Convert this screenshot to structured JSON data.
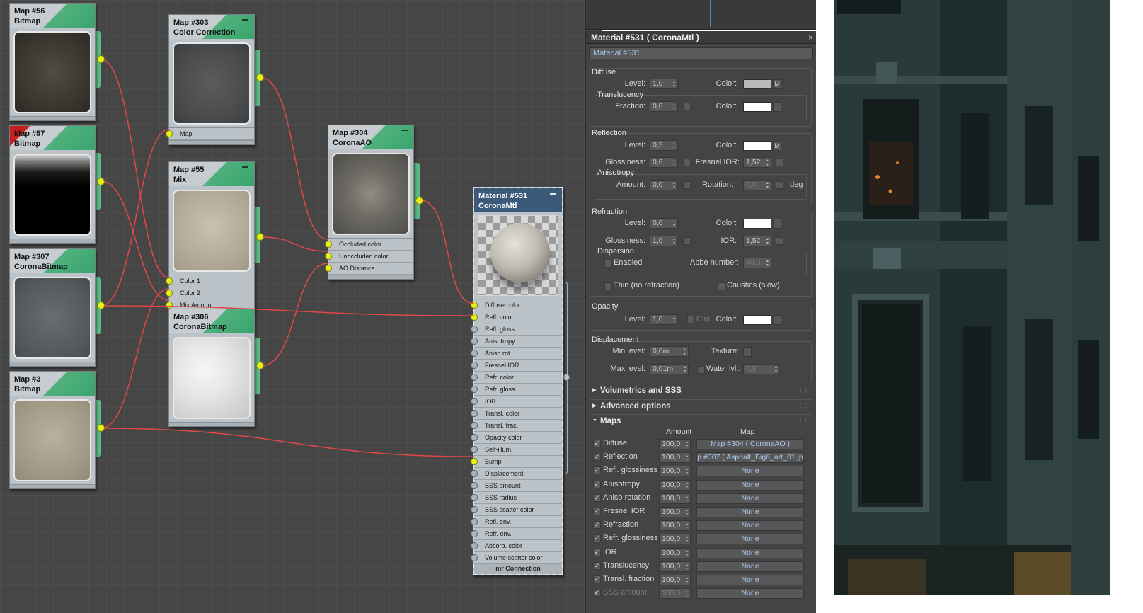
{
  "nodes": {
    "map56": {
      "title": "Map #56",
      "type": "Bitmap"
    },
    "map57": {
      "title": "Map #57",
      "type": "Bitmap"
    },
    "map307": {
      "title": "Map #307",
      "type": "CoronaBitmap"
    },
    "map3": {
      "title": "Map #3",
      "type": "Bitmap"
    },
    "map303": {
      "title": "Map #303",
      "type": "Color Correction",
      "inputs": [
        "Map"
      ]
    },
    "map55": {
      "title": "Map #55",
      "type": "Mix",
      "inputs": [
        "Color 1",
        "Color 2",
        "Mix Amount"
      ]
    },
    "map306": {
      "title": "Map #306",
      "type": "CoronaBitmap"
    },
    "map304": {
      "title": "Map #304",
      "type": "CoronaAO",
      "inputs": [
        "Occluded color",
        "Unoccluded color",
        "AO Distance"
      ]
    },
    "material": {
      "title": "Material #531",
      "type": "CoronaMtl",
      "inputs": [
        "Diffuse color",
        "Refl. color",
        "Refl. gloss.",
        "Anisotropy",
        "Aniso rot.",
        "Fresnel IOR",
        "Refr. color",
        "Refr. gloss.",
        "IOR",
        "Transl. color",
        "Transl. frac.",
        "Opacity color",
        "Self-illum.",
        "Bump",
        "Displacement",
        "SSS amount",
        "SSS radius",
        "SSS scatter color",
        "Refl. env.",
        "Refr. env.",
        "Absorb. color",
        "Volume scatter color"
      ],
      "connected": [
        0,
        1,
        13
      ],
      "footer": "mr Connection"
    }
  },
  "panel": {
    "title": "Material #531  ( CoronaMtl )",
    "close": "×",
    "name": "Material #531",
    "diffuse": {
      "header": "Diffuse",
      "level_label": "Level:",
      "level": "1,0",
      "color_label": "Color:",
      "color": "#b9b9b9",
      "m": "M",
      "translucency": {
        "header": "Translucency",
        "fraction_label": "Fraction:",
        "fraction": "0,0",
        "color_label": "Color:",
        "color": "#ffffff"
      }
    },
    "reflection": {
      "header": "Reflection",
      "level_label": "Level:",
      "level": "0,5",
      "color_label": "Color:",
      "color": "#ffffff",
      "m": "M",
      "gloss_label": "Glossiness:",
      "gloss": "0,6",
      "fresnel_label": "Fresnel IOR:",
      "fresnel": "1,52",
      "anisotropy": {
        "header": "Anisotropy",
        "amount_label": "Amount:",
        "amount": "0,0",
        "rotation_label": "Rotation:",
        "rotation": "0,0",
        "unit": "deg"
      }
    },
    "refraction": {
      "header": "Refraction",
      "level_label": "Level:",
      "level": "0,0",
      "color_label": "Color:",
      "color": "#ffffff",
      "gloss_label": "Glossiness:",
      "gloss": "1,0",
      "ior_label": "IOR:",
      "ior": "1,52",
      "dispersion": {
        "header": "Dispersion",
        "enabled_label": "Enabled",
        "abbe_label": "Abbe number:",
        "abbe": "40,0"
      },
      "thin_label": "Thin (no refraction)",
      "caustics_label": "Caustics (slow)"
    },
    "opacity": {
      "header": "Opacity",
      "level_label": "Level:",
      "level": "1,0",
      "clip_label": "Clip",
      "color_label": "Color:",
      "color": "#ffffff"
    },
    "displacement": {
      "header": "Displacement",
      "min_label": "Min level:",
      "min": "0,0m",
      "texture_label": "Texture:",
      "max_label": "Max level:",
      "max": "0,01m",
      "water_label": "Water lvl.:",
      "water": "0,5"
    },
    "rollouts": [
      "Volumetrics and SSS",
      "Advanced options",
      "Maps"
    ],
    "maps": {
      "amount_header": "Amount",
      "map_header": "Map",
      "rows": [
        {
          "label": "Diffuse",
          "amount": "100,0",
          "map": "Map #304  ( CoronaAO )"
        },
        {
          "label": "Reflection",
          "amount": "100,0",
          "map": "p #307 ( Asphalt_Big6_art_01.jp"
        },
        {
          "label": "Refl. glossiness",
          "amount": "100,0",
          "map": "None"
        },
        {
          "label": "Anisotropy",
          "amount": "100,0",
          "map": "None"
        },
        {
          "label": "Aniso rotation",
          "amount": "100,0",
          "map": "None"
        },
        {
          "label": "Fresnel IOR",
          "amount": "100,0",
          "map": "None"
        },
        {
          "label": "Refraction",
          "amount": "100,0",
          "map": "None"
        },
        {
          "label": "Refr. glossiness",
          "amount": "100,0",
          "map": "None"
        },
        {
          "label": "IOR",
          "amount": "100,0",
          "map": "None"
        },
        {
          "label": "Translucency",
          "amount": "100,0",
          "map": "None"
        },
        {
          "label": "Transl. fraction",
          "amount": "100,0",
          "map": "None"
        },
        {
          "label": "SSS amount",
          "amount": "100,0",
          "map": "None"
        }
      ]
    }
  },
  "check_glyph": "✓",
  "colors": {
    "canvas": "#464646",
    "wire": "#e04848",
    "socket": "#e6ef1c",
    "node_header": "#4fb17d",
    "panel": "#444444"
  }
}
